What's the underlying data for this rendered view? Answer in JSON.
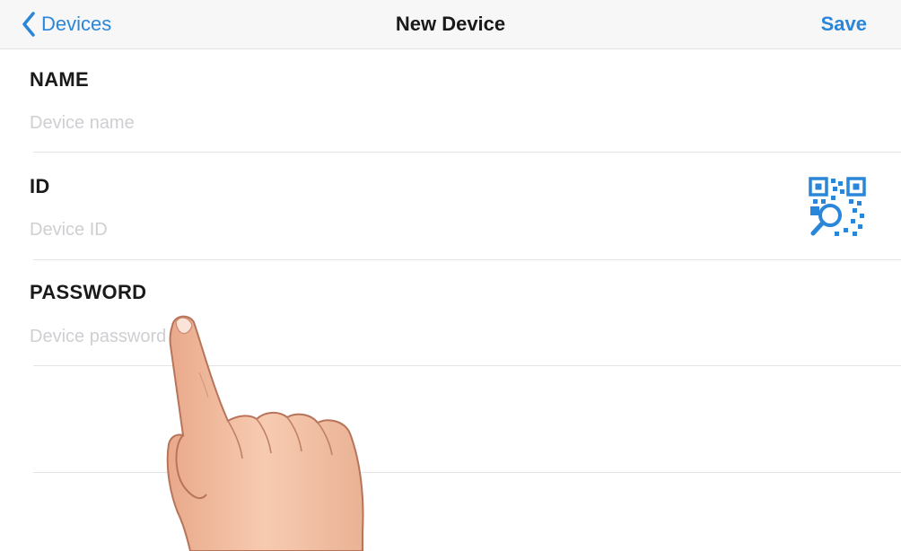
{
  "navbar": {
    "back_label": "Devices",
    "title": "New Device",
    "save_label": "Save",
    "accent_color": "#2a86d9"
  },
  "form": {
    "fields": [
      {
        "label": "NAME",
        "placeholder": "Device name",
        "value": ""
      },
      {
        "label": "ID",
        "placeholder": "Device ID",
        "value": ""
      },
      {
        "label": "PASSWORD",
        "placeholder": "Device password",
        "value": ""
      }
    ],
    "qr_icon": "qr-scan-icon"
  },
  "overlay": {
    "icon": "pointing-hand-icon"
  }
}
